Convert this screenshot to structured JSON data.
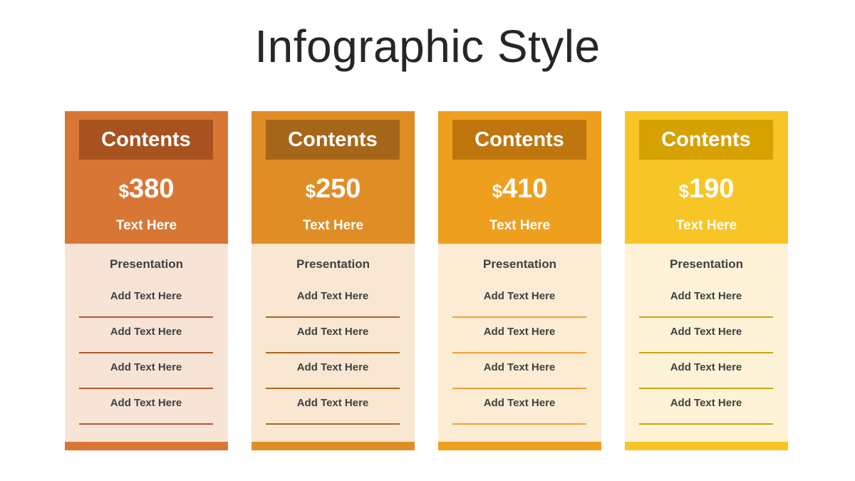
{
  "title": "Infographic Style",
  "cards": [
    {
      "header": "Contents",
      "currency": "$",
      "price": "380",
      "subtitle": "Text Here",
      "body_title": "Presentation",
      "items": [
        "Add Text Here",
        "Add Text Here",
        "Add Text Here",
        "Add Text Here"
      ],
      "colors": {
        "top": "#d87633",
        "header": "#a8521f",
        "body": "#f8e4d6",
        "line": "#b0592a",
        "foot": "#d87633"
      }
    },
    {
      "header": "Contents",
      "currency": "$",
      "price": "250",
      "subtitle": "Text Here",
      "body_title": "Presentation",
      "items": [
        "Add Text Here",
        "Add Text Here",
        "Add Text Here",
        "Add Text Here"
      ],
      "colors": {
        "top": "#e08d25",
        "header": "#a6661a",
        "body": "#f9e7d1",
        "line": "#a8671b",
        "foot": "#e08d25"
      }
    },
    {
      "header": "Contents",
      "currency": "$",
      "price": "410",
      "subtitle": "Text Here",
      "body_title": "Presentation",
      "items": [
        "Add Text Here",
        "Add Text Here",
        "Add Text Here",
        "Add Text Here"
      ],
      "colors": {
        "top": "#ef9f1e",
        "header": "#bf760e",
        "body": "#fcecd3",
        "line": "#f0a030",
        "foot": "#ef9f1e"
      }
    },
    {
      "header": "Contents",
      "currency": "$",
      "price": "190",
      "subtitle": "Text Here",
      "body_title": "Presentation",
      "items": [
        "Add Text Here",
        "Add Text Here",
        "Add Text Here",
        "Add Text Here"
      ],
      "colors": {
        "top": "#f8c526",
        "header": "#d5a202",
        "body": "#fef3d6",
        "line": "#c8a512",
        "foot": "#f8c526"
      }
    }
  ]
}
